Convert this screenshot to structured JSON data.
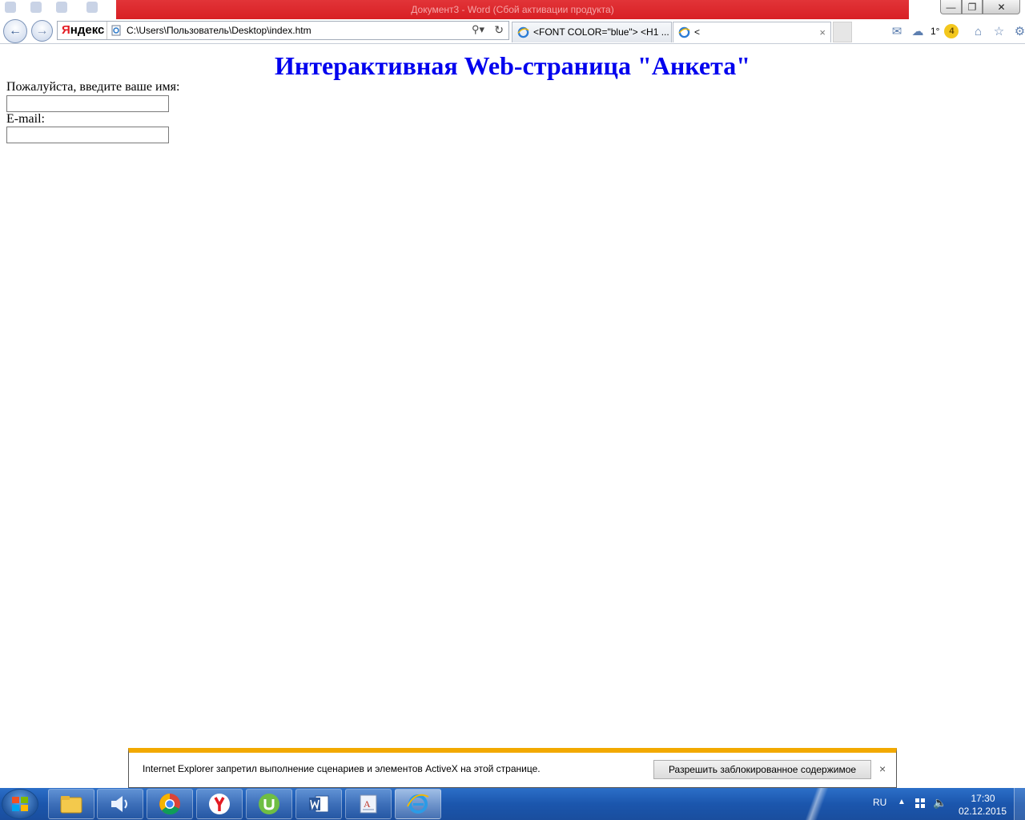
{
  "window": {
    "background_title": "Документ3 - Word (Сбой активации продукта)",
    "minimize_symbol": "—",
    "restore_symbol": "❐",
    "close_symbol": "✕"
  },
  "browser": {
    "yandex_logo_first": "Я",
    "yandex_logo_rest": "ндекс",
    "url": "C:\\Users\\Пользователь\\Desktop\\index.htm",
    "tabs": [
      {
        "label": "<FONT COLOR=\"blue\"> <H1 ..."
      },
      {
        "label": "<"
      }
    ],
    "tab_close": "×",
    "weather": "1°",
    "badge_count": "4"
  },
  "page": {
    "title": "Интерактивная Web-страница \"Анкета\"",
    "name_label": "Пожалуйста, введите ваше имя:",
    "name_value": "",
    "email_label": "E-mail:",
    "email_value": ""
  },
  "notification": {
    "text": "Internet Explorer запретил выполнение сценариев и элементов ActiveX на этой странице.",
    "allow_button": "Разрешить заблокированное содержимое",
    "close_symbol": "×",
    "accent_color": "#f2a900"
  },
  "taskbar": {
    "language": "RU",
    "time": "17:30",
    "date": "02.12.2015",
    "apps": [
      "file-explorer",
      "volume-app",
      "chrome",
      "yandex-browser",
      "utorrent",
      "word",
      "reader",
      "internet-explorer"
    ]
  },
  "colors": {
    "title_blue": "#0000ee",
    "taskbar_blue": "#1b56ad"
  }
}
